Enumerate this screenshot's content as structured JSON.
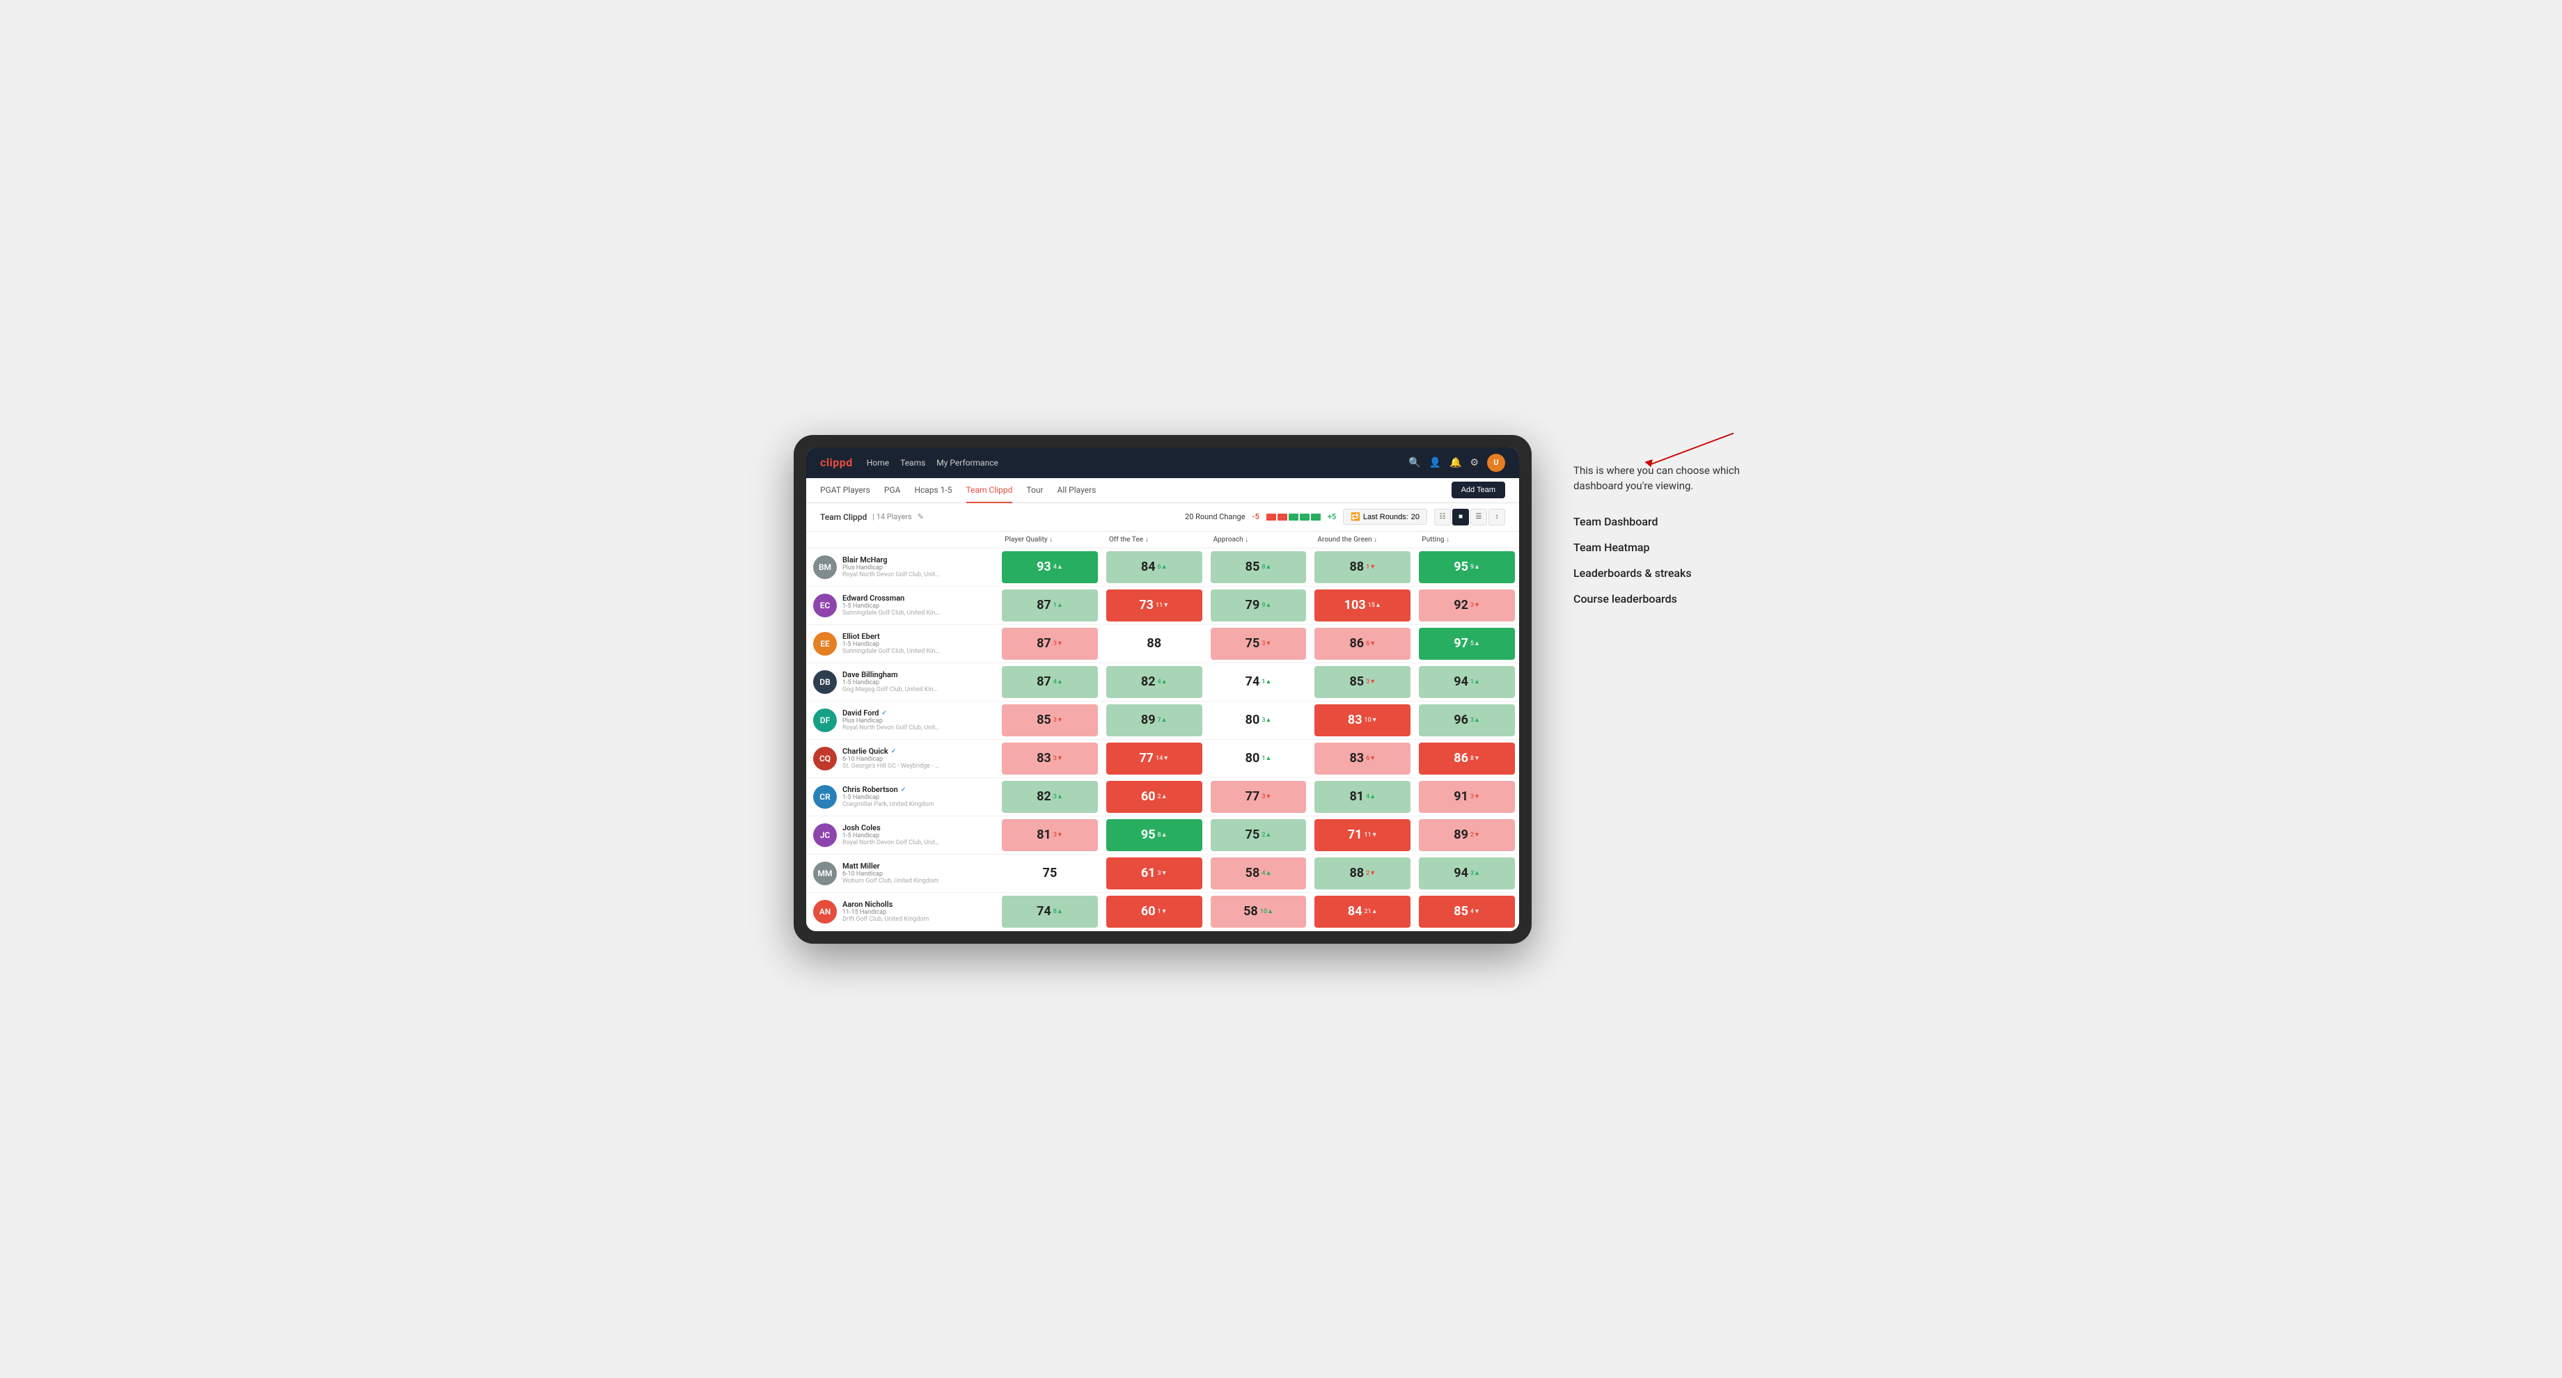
{
  "annotation": {
    "intro": "This is where you can choose which dashboard you're viewing.",
    "items": [
      "Team Dashboard",
      "Team Heatmap",
      "Leaderboards & streaks",
      "Course leaderboards"
    ]
  },
  "navbar": {
    "logo": "clippd",
    "nav_items": [
      "Home",
      "Teams",
      "My Performance"
    ],
    "icons": [
      "search",
      "person",
      "bell",
      "settings"
    ]
  },
  "subnav": {
    "tabs": [
      "PGAT Players",
      "PGA",
      "Hcaps 1-5",
      "Team Clippd",
      "Tour",
      "All Players"
    ],
    "active_tab": "Team Clippd",
    "add_team_label": "Add Team"
  },
  "team_bar": {
    "name": "Team Clippd",
    "separator": "|",
    "count": "14 Players",
    "round_change_label": "20 Round Change",
    "change_neg": "-5",
    "change_pos": "+5",
    "last_rounds_label": "Last Rounds:",
    "last_rounds_value": "20"
  },
  "table": {
    "columns": [
      "Player Quality ↓",
      "Off the Tee ↓",
      "Approach ↓",
      "Around the Green ↓",
      "Putting ↓"
    ],
    "rows": [
      {
        "name": "Blair McHarg",
        "handicap": "Plus Handicap",
        "club": "Royal North Devon Golf Club, United Kingdom",
        "avatar_bg": "#7f8c8d",
        "initials": "BM",
        "stats": [
          {
            "value": "93",
            "change": "4▲",
            "dir": "up",
            "heat": "heat-dark-green"
          },
          {
            "value": "84",
            "change": "6▲",
            "dir": "up",
            "heat": "heat-light-green"
          },
          {
            "value": "85",
            "change": "8▲",
            "dir": "up",
            "heat": "heat-light-green"
          },
          {
            "value": "88",
            "change": "1▼",
            "dir": "down",
            "heat": "heat-light-green"
          },
          {
            "value": "95",
            "change": "9▲",
            "dir": "up",
            "heat": "heat-dark-green"
          }
        ]
      },
      {
        "name": "Edward Crossman",
        "handicap": "1-5 Handicap",
        "club": "Sunningdale Golf Club, United Kingdom",
        "avatar_bg": "#8e44ad",
        "initials": "EC",
        "stats": [
          {
            "value": "87",
            "change": "1▲",
            "dir": "up",
            "heat": "heat-light-green"
          },
          {
            "value": "73",
            "change": "11▼",
            "dir": "down",
            "heat": "heat-dark-red"
          },
          {
            "value": "79",
            "change": "9▲",
            "dir": "up",
            "heat": "heat-light-green"
          },
          {
            "value": "103",
            "change": "15▲",
            "dir": "up",
            "heat": "heat-dark-red"
          },
          {
            "value": "92",
            "change": "3▼",
            "dir": "down",
            "heat": "heat-light-red"
          }
        ]
      },
      {
        "name": "Elliot Ebert",
        "handicap": "1-5 Handicap",
        "club": "Sunningdale Golf Club, United Kingdom",
        "avatar_bg": "#e67e22",
        "initials": "EE",
        "stats": [
          {
            "value": "87",
            "change": "3▼",
            "dir": "down",
            "heat": "heat-light-red"
          },
          {
            "value": "88",
            "change": "",
            "dir": "",
            "heat": "heat-white"
          },
          {
            "value": "75",
            "change": "3▼",
            "dir": "down",
            "heat": "heat-light-red"
          },
          {
            "value": "86",
            "change": "6▼",
            "dir": "down",
            "heat": "heat-light-red"
          },
          {
            "value": "97",
            "change": "5▲",
            "dir": "up",
            "heat": "heat-dark-green"
          }
        ]
      },
      {
        "name": "Dave Billingham",
        "handicap": "1-5 Handicap",
        "club": "Gog Magog Golf Club, United Kingdom",
        "avatar_bg": "#2c3e50",
        "initials": "DB",
        "stats": [
          {
            "value": "87",
            "change": "4▲",
            "dir": "up",
            "heat": "heat-light-green"
          },
          {
            "value": "82",
            "change": "4▲",
            "dir": "up",
            "heat": "heat-light-green"
          },
          {
            "value": "74",
            "change": "1▲",
            "dir": "up",
            "heat": "heat-white"
          },
          {
            "value": "85",
            "change": "3▼",
            "dir": "down",
            "heat": "heat-light-green"
          },
          {
            "value": "94",
            "change": "1▲",
            "dir": "up",
            "heat": "heat-light-green"
          }
        ]
      },
      {
        "name": "David Ford",
        "handicap": "Plus Handicap",
        "club": "Royal North Devon Golf Club, United Kingdom",
        "avatar_bg": "#16a085",
        "initials": "DF",
        "verified": true,
        "stats": [
          {
            "value": "85",
            "change": "3▼",
            "dir": "down",
            "heat": "heat-light-red"
          },
          {
            "value": "89",
            "change": "7▲",
            "dir": "up",
            "heat": "heat-light-green"
          },
          {
            "value": "80",
            "change": "3▲",
            "dir": "up",
            "heat": "heat-white"
          },
          {
            "value": "83",
            "change": "10▼",
            "dir": "down",
            "heat": "heat-dark-red"
          },
          {
            "value": "96",
            "change": "3▲",
            "dir": "up",
            "heat": "heat-light-green"
          }
        ]
      },
      {
        "name": "Charlie Quick",
        "handicap": "6-10 Handicap",
        "club": "St. George's Hill GC - Weybridge - Surrey, Uni...",
        "avatar_bg": "#c0392b",
        "initials": "CQ",
        "verified": true,
        "stats": [
          {
            "value": "83",
            "change": "3▼",
            "dir": "down",
            "heat": "heat-light-red"
          },
          {
            "value": "77",
            "change": "14▼",
            "dir": "down",
            "heat": "heat-dark-red"
          },
          {
            "value": "80",
            "change": "1▲",
            "dir": "up",
            "heat": "heat-white"
          },
          {
            "value": "83",
            "change": "6▼",
            "dir": "down",
            "heat": "heat-light-red"
          },
          {
            "value": "86",
            "change": "8▼",
            "dir": "down",
            "heat": "heat-dark-red"
          }
        ]
      },
      {
        "name": "Chris Robertson",
        "handicap": "1-5 Handicap",
        "club": "Craigmillar Park, United Kingdom",
        "avatar_bg": "#2980b9",
        "initials": "CR",
        "verified": true,
        "stats": [
          {
            "value": "82",
            "change": "3▲",
            "dir": "up",
            "heat": "heat-light-green"
          },
          {
            "value": "60",
            "change": "2▲",
            "dir": "up",
            "heat": "heat-dark-red"
          },
          {
            "value": "77",
            "change": "3▼",
            "dir": "down",
            "heat": "heat-light-red"
          },
          {
            "value": "81",
            "change": "4▲",
            "dir": "up",
            "heat": "heat-light-green"
          },
          {
            "value": "91",
            "change": "3▼",
            "dir": "down",
            "heat": "heat-light-red"
          }
        ]
      },
      {
        "name": "Josh Coles",
        "handicap": "1-5 Handicap",
        "club": "Royal North Devon Golf Club, United Kingdom",
        "avatar_bg": "#8e44ad",
        "initials": "JC",
        "stats": [
          {
            "value": "81",
            "change": "3▼",
            "dir": "down",
            "heat": "heat-light-red"
          },
          {
            "value": "95",
            "change": "8▲",
            "dir": "up",
            "heat": "heat-dark-green"
          },
          {
            "value": "75",
            "change": "2▲",
            "dir": "up",
            "heat": "heat-light-green"
          },
          {
            "value": "71",
            "change": "11▼",
            "dir": "down",
            "heat": "heat-dark-red"
          },
          {
            "value": "89",
            "change": "2▼",
            "dir": "down",
            "heat": "heat-light-red"
          }
        ]
      },
      {
        "name": "Matt Miller",
        "handicap": "6-10 Handicap",
        "club": "Woburn Golf Club, United Kingdom",
        "avatar_bg": "#7f8c8d",
        "initials": "MM",
        "stats": [
          {
            "value": "75",
            "change": "",
            "dir": "",
            "heat": "heat-white"
          },
          {
            "value": "61",
            "change": "3▼",
            "dir": "down",
            "heat": "heat-dark-red"
          },
          {
            "value": "58",
            "change": "4▲",
            "dir": "up",
            "heat": "heat-light-red"
          },
          {
            "value": "88",
            "change": "2▼",
            "dir": "down",
            "heat": "heat-light-green"
          },
          {
            "value": "94",
            "change": "3▲",
            "dir": "up",
            "heat": "heat-light-green"
          }
        ]
      },
      {
        "name": "Aaron Nicholls",
        "handicap": "11-15 Handicap",
        "club": "Drift Golf Club, United Kingdom",
        "avatar_bg": "#e74c3c",
        "initials": "AN",
        "stats": [
          {
            "value": "74",
            "change": "8▲",
            "dir": "up",
            "heat": "heat-light-green"
          },
          {
            "value": "60",
            "change": "1▼",
            "dir": "down",
            "heat": "heat-dark-red"
          },
          {
            "value": "58",
            "change": "10▲",
            "dir": "up",
            "heat": "heat-light-red"
          },
          {
            "value": "84",
            "change": "21▲",
            "dir": "up",
            "heat": "heat-dark-red"
          },
          {
            "value": "85",
            "change": "4▼",
            "dir": "down",
            "heat": "heat-dark-red"
          }
        ]
      }
    ]
  }
}
